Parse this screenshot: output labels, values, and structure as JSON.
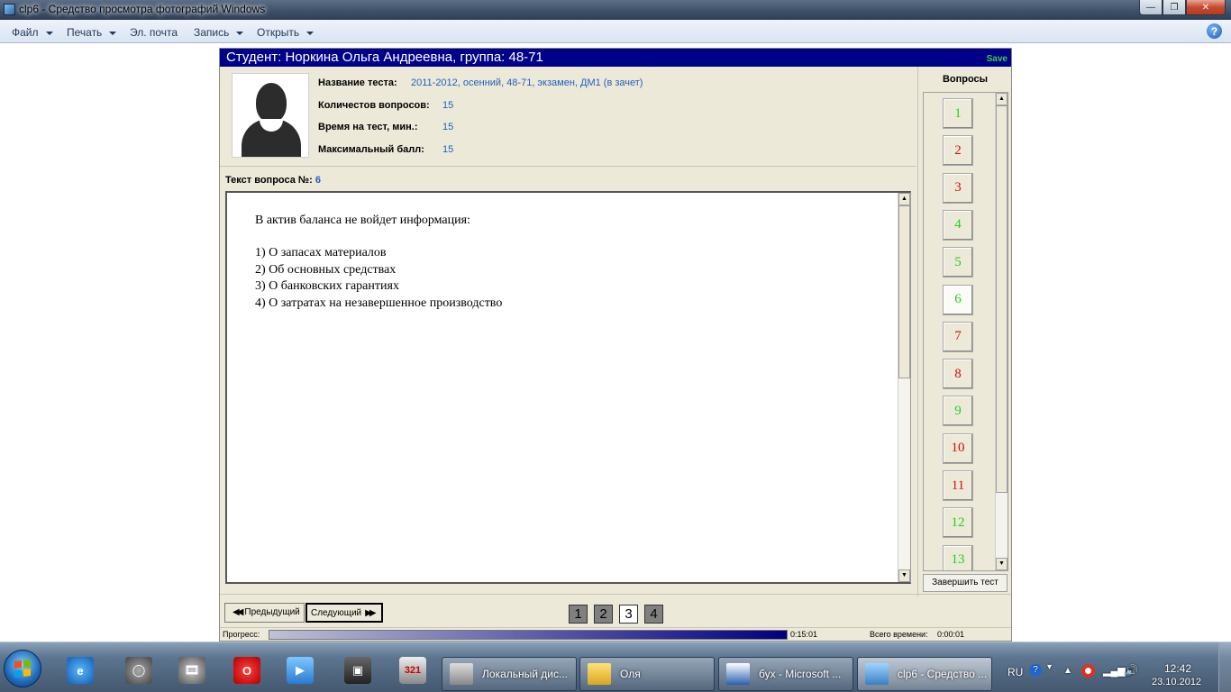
{
  "window": {
    "title": "clp6 - Средство просмотра фотографий Windows"
  },
  "menu": {
    "file": "Файл",
    "print": "Печать",
    "email": "Эл. почта",
    "record": "Запись",
    "open": "Открыть"
  },
  "test_app": {
    "header": "Студент: Норкина Ольга Андреевна, группа: 48-71",
    "save_label": "Save",
    "info": {
      "test_name_label": "Название теста:",
      "test_name_value": "2011-2012, осенний, 48-71, экзамен, ДМ1 (в зачет)",
      "questions_count_label": "Количестов вопросов:",
      "questions_count_value": "15",
      "time_label": "Время на тест, мин.:",
      "time_value": "15",
      "max_score_label": "Максимальный балл:",
      "max_score_value": "15"
    },
    "question_label": "Текст вопроса №:",
    "question_number": "6",
    "question": {
      "text": "В актив баланса не войдет информация:",
      "answers": [
        "1)  О запасах материалов",
        "2)  Об основных средствах",
        "3)  О банковских гарантиях",
        "4)  О затратах на незавершенное производство"
      ]
    },
    "sidebar": {
      "title": "Вопросы",
      "questions": [
        {
          "label": "1",
          "status": "green"
        },
        {
          "label": "2",
          "status": "red"
        },
        {
          "label": "3",
          "status": "red"
        },
        {
          "label": "4",
          "status": "green"
        },
        {
          "label": "5",
          "status": "green"
        },
        {
          "label": "6",
          "status": "green",
          "current": true
        },
        {
          "label": "7",
          "status": "red"
        },
        {
          "label": "8",
          "status": "red"
        },
        {
          "label": "9",
          "status": "green"
        },
        {
          "label": "10",
          "status": "red"
        },
        {
          "label": "11",
          "status": "red"
        },
        {
          "label": "12",
          "status": "green"
        },
        {
          "label": "13",
          "status": "green"
        }
      ],
      "finish_button": "Завершить тест"
    },
    "nav": {
      "prev": "Предыдущий",
      "next": "Следующий",
      "pages": [
        "1",
        "2",
        "3",
        "4"
      ],
      "active_page": "3"
    },
    "status": {
      "progress_label": "Прогресс:",
      "progress_time": "0:15:01",
      "total_time_label": "Всего времени:",
      "total_time_value": "0:00:01",
      "progress_fraction": 1.0
    }
  },
  "taskbar": {
    "tasks": [
      {
        "label": "Локальный дис...",
        "icon": "drive-icon"
      },
      {
        "label": "Оля",
        "icon": "folder-icon"
      },
      {
        "label": "бух - Microsoft ...",
        "icon": "word-icon"
      },
      {
        "label": "clp6 - Средство ...",
        "icon": "photo-viewer-icon"
      }
    ],
    "language": "RU",
    "time": "12:42",
    "date": "23.10.2012"
  },
  "colors": {
    "header_bg": "#000088",
    "answered_green": "#22d022",
    "wrong_red": "#d01010",
    "value_blue": "#1f5fbf"
  }
}
